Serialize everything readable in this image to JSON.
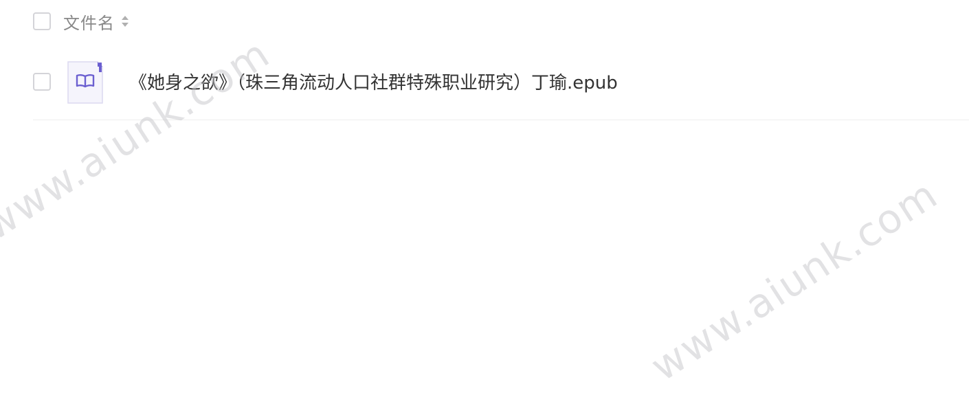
{
  "header": {
    "column_label": "文件名",
    "sort_icon": "sort-icon"
  },
  "files": [
    {
      "name": "《她身之欲》（珠三角流动人口社群特殊职业研究）丁瑜.epub",
      "icon": "ebook-file-icon"
    }
  ],
  "watermarks": [
    "www.aiunk.com",
    "www.aiunk.com"
  ],
  "colors": {
    "icon_accent": "#6b5fd0",
    "icon_bg": "#f5f4fc",
    "checkbox_border": "#d4d4d8",
    "header_text": "#888888",
    "row_text": "#333333",
    "divider": "#eeeeee"
  }
}
